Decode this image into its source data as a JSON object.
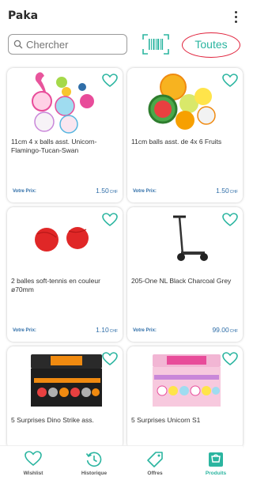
{
  "colors": {
    "accent": "#2bb5a0",
    "highlight": "#e0203a",
    "price": "#2f6ea8"
  },
  "header": {
    "title": "Paka"
  },
  "search": {
    "placeholder": "Chercher",
    "all_label": "Toutes"
  },
  "products": [
    {
      "name": "11cm 4 x balls asst. Unicorn-Flamingo-Tucan-Swan",
      "price_label": "Votre Prix:",
      "price": "1.50",
      "currency": "CHF",
      "icon": "unicorn-flamingo-balls"
    },
    {
      "name": "11cm balls asst. de 4x 6 Fruits",
      "price_label": "Votre Prix:",
      "price": "1.50",
      "currency": "CHF",
      "icon": "fruit-balls"
    },
    {
      "name": "2 balles soft-tennis en couleur ø70mm",
      "price_label": "Votre Prix:",
      "price": "1.10",
      "currency": "CHF",
      "icon": "red-soft-tennis-balls"
    },
    {
      "name": "205-One NL Black Charcoal Grey",
      "price_label": "Votre Prix:",
      "price": "99.00",
      "currency": "CHF",
      "icon": "scooter"
    },
    {
      "name": "5 Surprises Dino Strike ass.",
      "icon": "dino-display-box"
    },
    {
      "name": "5 Surprises Unicorn S1",
      "icon": "unicorn-display-box"
    }
  ],
  "tabs": [
    {
      "label": "Wishlist",
      "icon": "heart-icon"
    },
    {
      "label": "Historique",
      "icon": "history-icon"
    },
    {
      "label": "Offres",
      "icon": "tag-icon"
    },
    {
      "label": "Produits",
      "icon": "cart-icon",
      "active": true
    }
  ]
}
